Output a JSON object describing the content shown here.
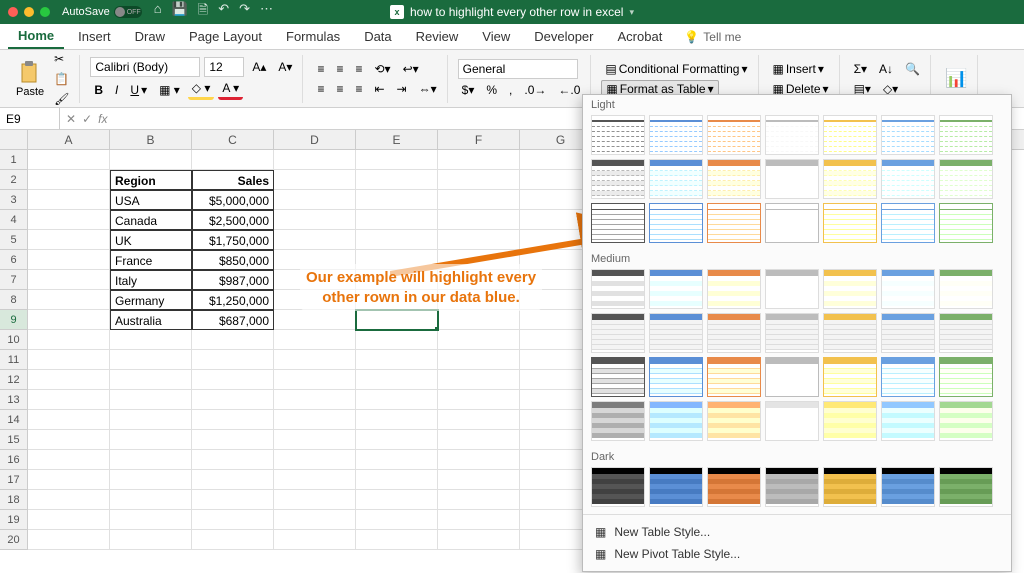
{
  "titlebar": {
    "autosave": "AutoSave",
    "filename": "how to highlight every other row in excel"
  },
  "ribbon_tabs": [
    "Home",
    "Insert",
    "Draw",
    "Page Layout",
    "Formulas",
    "Data",
    "Review",
    "View",
    "Developer",
    "Acrobat"
  ],
  "tellme": "Tell me",
  "ribbon": {
    "paste": "Paste",
    "font_name": "Calibri (Body)",
    "font_size": "12",
    "number_format": "General",
    "cond_fmt": "Conditional Formatting",
    "fmt_table": "Format as Table",
    "insert": "Insert",
    "delete": "Delete"
  },
  "namebox": "E9",
  "columns": [
    "A",
    "B",
    "C",
    "D",
    "E",
    "F",
    "G"
  ],
  "row_count": 20,
  "table": {
    "header": [
      "Region",
      "Sales"
    ],
    "rows": [
      [
        "USA",
        "$5,000,000"
      ],
      [
        "Canada",
        "$2,500,000"
      ],
      [
        "UK",
        "$1,750,000"
      ],
      [
        "France",
        "$850,000"
      ],
      [
        "Italy",
        "$987,000"
      ],
      [
        "Germany",
        "$1,250,000"
      ],
      [
        "Australia",
        "$687,000"
      ]
    ]
  },
  "annotation": {
    "line1": "Our example will highlight every",
    "line2": "other rown in our data blue."
  },
  "gallery": {
    "light": "Light",
    "medium": "Medium",
    "dark": "Dark",
    "new_style": "New Table Style...",
    "new_pivot": "New Pivot Table Style..."
  },
  "palette": [
    "#555555",
    "#5b8fd6",
    "#e88a4a",
    "#bcbcbc",
    "#f2c14e",
    "#6aa0e0",
    "#7bb06a"
  ]
}
